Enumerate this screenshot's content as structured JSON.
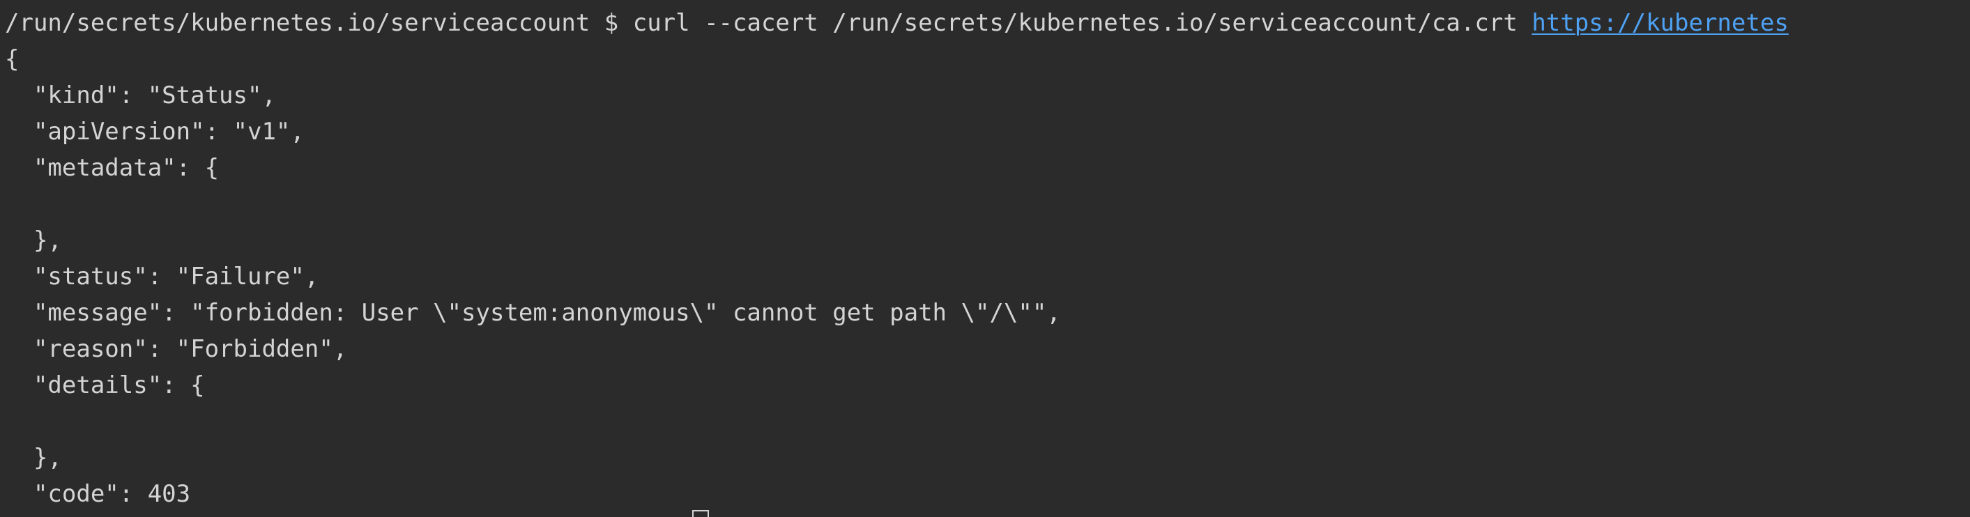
{
  "terminal": {
    "prompt_path": "/run/secrets/kubernetes.io/serviceaccount",
    "prompt_symbol": "$",
    "command": "curl --cacert /run/secrets/kubernetes.io/serviceaccount/ca.crt",
    "url": "https://kubernetes",
    "output_lines": [
      "{",
      "  \"kind\": \"Status\",",
      "  \"apiVersion\": \"v1\",",
      "  \"metadata\": {",
      "",
      "  },",
      "  \"status\": \"Failure\",",
      "  \"message\": \"forbidden: User \\\"system:anonymous\\\" cannot get path \\\"/\\\"\",",
      "  \"reason\": \"Forbidden\",",
      "  \"details\": {",
      "",
      "  },",
      "  \"code\": 403"
    ]
  },
  "colors": {
    "background": "#2b2b2b",
    "text": "#d4d4d4",
    "link": "#4ea1f3"
  }
}
